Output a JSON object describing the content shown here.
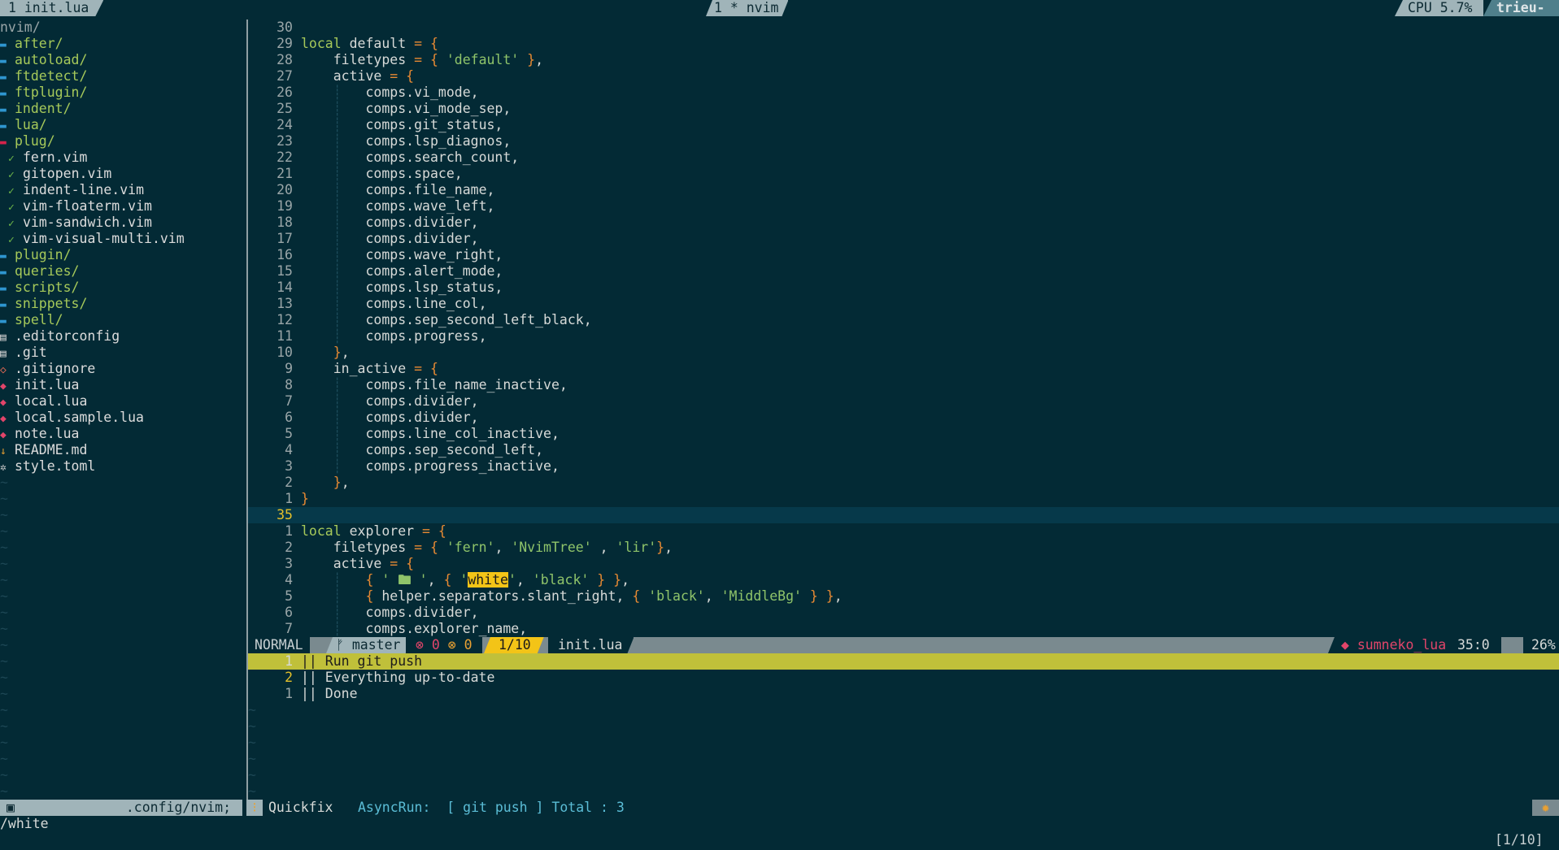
{
  "tabline": {
    "left_tab": "1 init.lua",
    "center_tab": "1 * nvim",
    "cpu": "CPU 5.7%",
    "host": "trieu-PC"
  },
  "explorer": {
    "root": "nvim/",
    "items": [
      {
        "icon": "folder-icon",
        "label": "after/",
        "kind": "dir"
      },
      {
        "icon": "folder-icon",
        "label": "autoload/",
        "kind": "dir"
      },
      {
        "icon": "folder-icon",
        "label": "ftdetect/",
        "kind": "dir"
      },
      {
        "icon": "folder-icon",
        "label": "ftplugin/",
        "kind": "dir"
      },
      {
        "icon": "folder-icon",
        "label": "indent/",
        "kind": "dir"
      },
      {
        "icon": "folder-icon",
        "label": "lua/",
        "kind": "dir"
      },
      {
        "icon": "folder-open-icon",
        "label": "plug/",
        "kind": "dir-open"
      },
      {
        "icon": "check-icon",
        "label": "fern.vim",
        "kind": "plug"
      },
      {
        "icon": "check-icon",
        "label": "gitopen.vim",
        "kind": "plug"
      },
      {
        "icon": "check-icon",
        "label": "indent-line.vim",
        "kind": "plug"
      },
      {
        "icon": "check-icon",
        "label": "vim-floaterm.vim",
        "kind": "plug"
      },
      {
        "icon": "check-icon",
        "label": "vim-sandwich.vim",
        "kind": "plug"
      },
      {
        "icon": "check-icon",
        "label": "vim-visual-multi.vim",
        "kind": "plug"
      },
      {
        "icon": "folder-icon",
        "label": "plugin/",
        "kind": "dir"
      },
      {
        "icon": "folder-icon",
        "label": "queries/",
        "kind": "dir"
      },
      {
        "icon": "folder-icon",
        "label": "scripts/",
        "kind": "dir"
      },
      {
        "icon": "folder-icon",
        "label": "snippets/",
        "kind": "dir"
      },
      {
        "icon": "folder-icon",
        "label": "spell/",
        "kind": "dir"
      },
      {
        "icon": "document-icon",
        "label": ".editorconfig",
        "kind": "file"
      },
      {
        "icon": "document-icon",
        "label": ".git",
        "kind": "file"
      },
      {
        "icon": "git-icon",
        "label": ".gitignore",
        "kind": "file"
      },
      {
        "icon": "lua-icon",
        "label": "init.lua",
        "kind": "file"
      },
      {
        "icon": "lua-icon",
        "label": "local.lua",
        "kind": "file"
      },
      {
        "icon": "lua-icon",
        "label": "local.sample.lua",
        "kind": "file"
      },
      {
        "icon": "lua-icon",
        "label": "note.lua",
        "kind": "file"
      },
      {
        "icon": "markdown-icon",
        "label": "README.md",
        "kind": "file"
      },
      {
        "icon": "gear-icon",
        "label": "style.toml",
        "kind": "file"
      }
    ]
  },
  "editor": {
    "lines": [
      {
        "n": "30",
        "text": ""
      },
      {
        "n": "29",
        "text": "local default = {"
      },
      {
        "n": "28",
        "text": "    filetypes = { 'default' },"
      },
      {
        "n": "27",
        "text": "    active = {"
      },
      {
        "n": "26",
        "text": "        comps.vi_mode,"
      },
      {
        "n": "25",
        "text": "        comps.vi_mode_sep,"
      },
      {
        "n": "24",
        "text": "        comps.git_status,"
      },
      {
        "n": "23",
        "text": "        comps.lsp_diagnos,"
      },
      {
        "n": "22",
        "text": "        comps.search_count,"
      },
      {
        "n": "21",
        "text": "        comps.space,"
      },
      {
        "n": "20",
        "text": "        comps.file_name,"
      },
      {
        "n": "19",
        "text": "        comps.wave_left,"
      },
      {
        "n": "18",
        "text": "        comps.divider,"
      },
      {
        "n": "17",
        "text": "        comps.divider,"
      },
      {
        "n": "16",
        "text": "        comps.wave_right,"
      },
      {
        "n": "15",
        "text": "        comps.alert_mode,"
      },
      {
        "n": "14",
        "text": "        comps.lsp_status,"
      },
      {
        "n": "13",
        "text": "        comps.line_col,"
      },
      {
        "n": "12",
        "text": "        comps.sep_second_left_black,"
      },
      {
        "n": "11",
        "text": "        comps.progress,"
      },
      {
        "n": "10",
        "text": "    },"
      },
      {
        "n": "9",
        "text": "    in_active = {"
      },
      {
        "n": "8",
        "text": "        comps.file_name_inactive,"
      },
      {
        "n": "7",
        "text": "        comps.divider,"
      },
      {
        "n": "6",
        "text": "        comps.divider,"
      },
      {
        "n": "5",
        "text": "        comps.line_col_inactive,"
      },
      {
        "n": "4",
        "text": "        comps.sep_second_left,"
      },
      {
        "n": "3",
        "text": "        comps.progress_inactive,"
      },
      {
        "n": "2",
        "text": "    },"
      },
      {
        "n": "1",
        "text": "}"
      },
      {
        "n": "35",
        "text": "",
        "current": true
      },
      {
        "n": "1",
        "text": "local explorer = {"
      },
      {
        "n": "2",
        "text": "    filetypes = { 'fern', 'NvimTree' , 'lir'},"
      },
      {
        "n": "3",
        "text": "    active = {"
      },
      {
        "n": "4",
        "text": "        { ' 🖿 ', { 'white', 'black' } },"
      },
      {
        "n": "5",
        "text": "        { helper.separators.slant_right, { 'black', 'MiddleBg' } },"
      },
      {
        "n": "6",
        "text": "        comps.divider,"
      },
      {
        "n": "7",
        "text": "        comps.explorer_name,"
      }
    ],
    "search_term": "white"
  },
  "statusline": {
    "mode": "NORMAL",
    "branch": "master",
    "errors": "0",
    "warnings": "0",
    "search_count": "1/10",
    "file": "init.lua",
    "lsp": "sumneko_lua",
    "position": "35:0",
    "percent": "26%"
  },
  "quickfix": {
    "rows": [
      {
        "n": "1",
        "text": "|| Run git push",
        "selected": true
      },
      {
        "n": "2",
        "text": "|| Everything up-to-date",
        "selected": false,
        "cur": true
      },
      {
        "n": "1",
        "text": "|| Done",
        "selected": false
      }
    ]
  },
  "bottombar": {
    "path": ".config/nvim;",
    "qf_label": "Quickfix",
    "async": "AsyncRun:  [ git push ] Total : 3"
  },
  "cmdline": "/white",
  "pager": "[1/10]"
}
